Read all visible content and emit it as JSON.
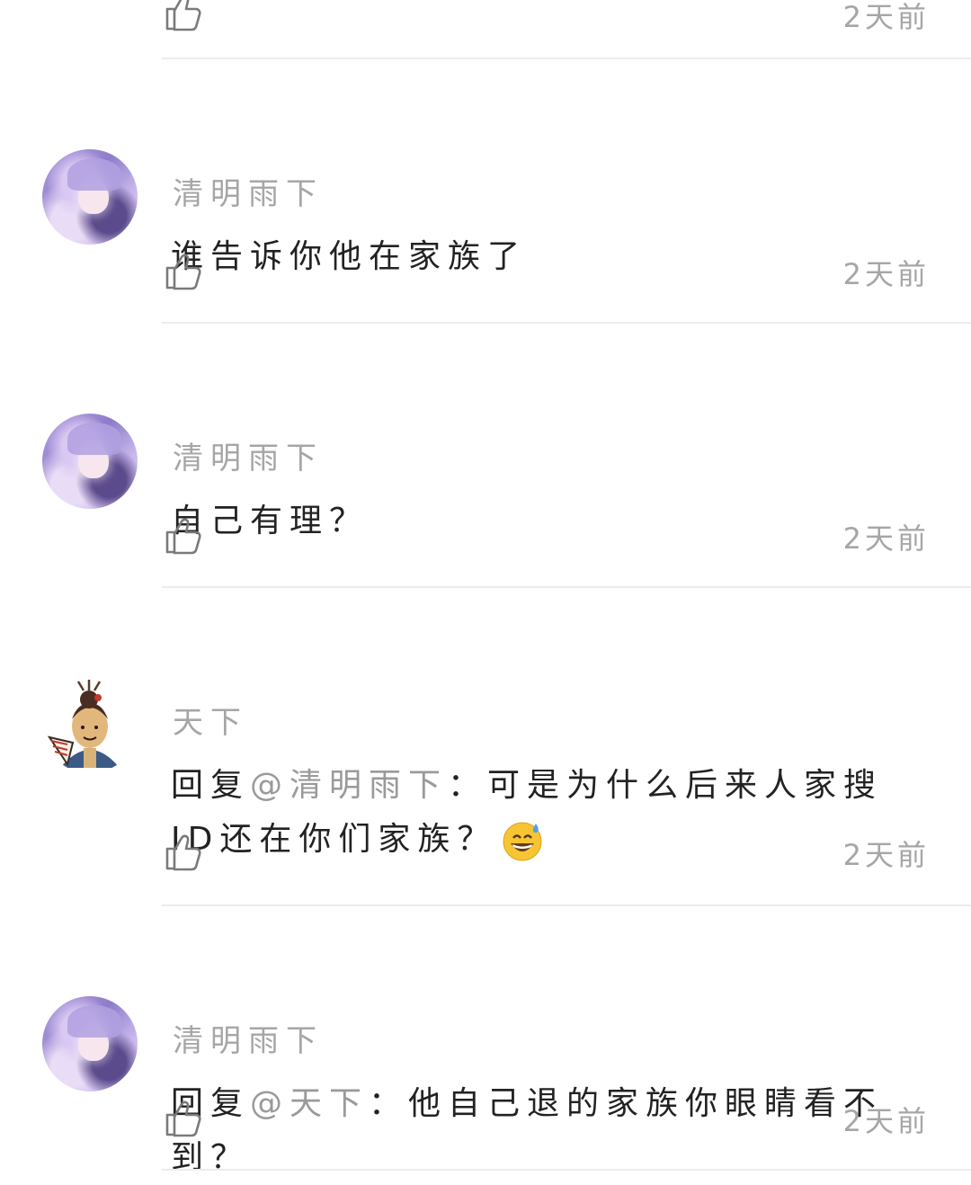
{
  "comments": [
    {
      "user": "",
      "text": "",
      "time": "2天前"
    },
    {
      "user": "清明雨下",
      "text": "谁告诉你他在家族了",
      "time": "2天前"
    },
    {
      "user": "清明雨下",
      "text": "自己有理？",
      "time": "2天前"
    },
    {
      "user": "天下",
      "reply_prefix": "回复",
      "mention": "@清明雨下",
      "text": "：可是为什么后来人家搜ID还在你们家族？",
      "emoji": "grinning-sweat-emoji",
      "time": "2天前"
    },
    {
      "user": "清明雨下",
      "reply_prefix": "回复",
      "mention": "@天下",
      "text": "：他自己退的家族你眼睛看不到？",
      "time": "2天前"
    }
  ],
  "icons": {
    "like": "thumbs-up-icon"
  },
  "colors": {
    "secondary_text": "#a6a6a6",
    "primary_text": "#222222",
    "divider": "#ececec",
    "background": "#ffffff"
  }
}
